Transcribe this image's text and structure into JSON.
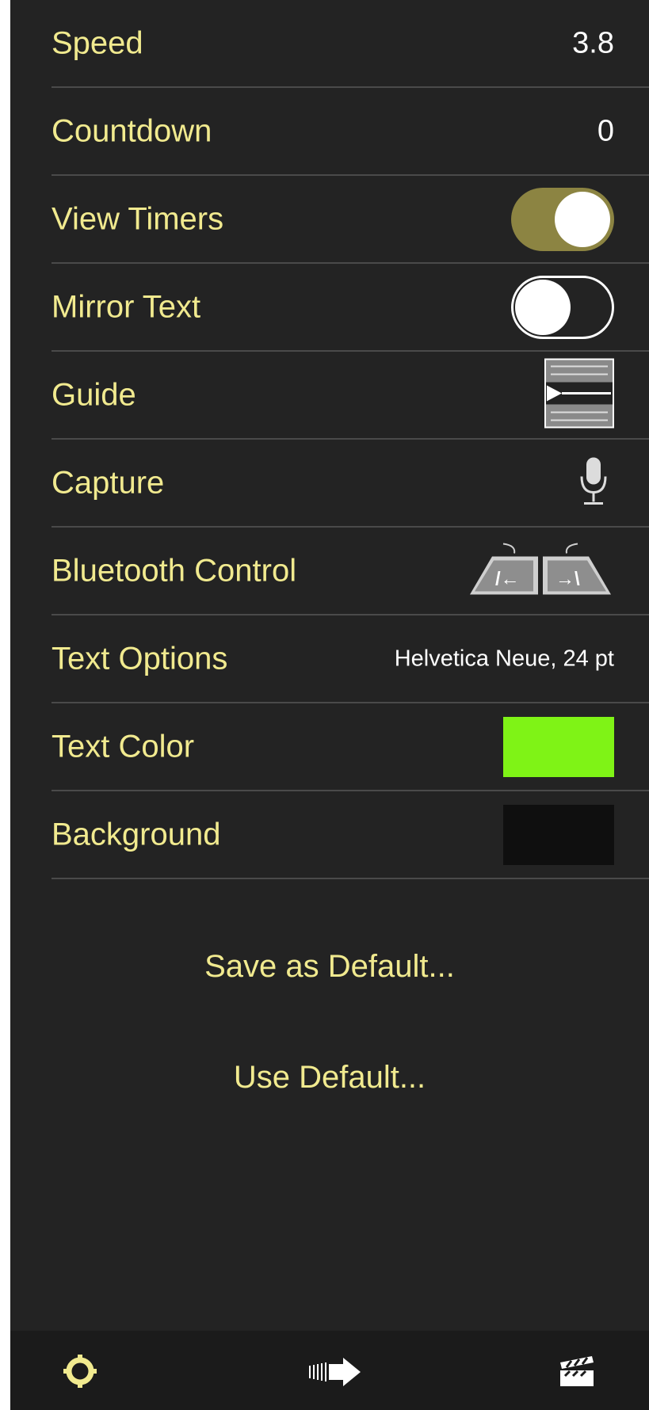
{
  "settings": {
    "speed": {
      "label": "Speed",
      "value": "3.8"
    },
    "countdown": {
      "label": "Countdown",
      "value": "0"
    },
    "view_timers": {
      "label": "View Timers",
      "on": true
    },
    "mirror_text": {
      "label": "Mirror Text",
      "on": false
    },
    "guide": {
      "label": "Guide",
      "icon": "guide-icon"
    },
    "capture": {
      "label": "Capture",
      "icon": "microphone-icon"
    },
    "bluetooth_control": {
      "label": "Bluetooth Control",
      "icon": "bluetooth-pedals-icon"
    },
    "text_options": {
      "label": "Text Options",
      "value": "Helvetica Neue, 24 pt"
    },
    "text_color": {
      "label": "Text Color",
      "color": "#7ff316"
    },
    "background": {
      "label": "Background",
      "color": "#0f0f0f"
    }
  },
  "actions": {
    "save_default": "Save as Default...",
    "use_default": "Use Default..."
  },
  "tabbar": {
    "items": [
      {
        "name": "settings",
        "icon": "gear-icon"
      },
      {
        "name": "play",
        "icon": "forward-arrow-icon"
      },
      {
        "name": "scripts",
        "icon": "clapperboard-icon"
      }
    ]
  },
  "colors": {
    "label": "#f1ea8f",
    "background": "#232323",
    "toggle_on": "#8c8442"
  }
}
